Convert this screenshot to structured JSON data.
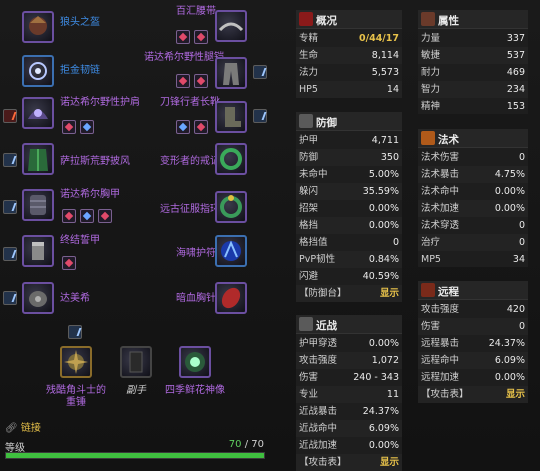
{
  "equipment": {
    "left": [
      {
        "name": "狼头之盔"
      },
      {
        "name": "拒金韧链"
      },
      {
        "name": "诺达希尔野性护肩"
      },
      {
        "name": "萨拉斯荒野披风"
      },
      {
        "name": "诺达希尔胸甲"
      },
      {
        "name": "终结誓甲"
      },
      {
        "name": "达美希"
      }
    ],
    "right": [
      {
        "name": "百汇腰带"
      },
      {
        "name": "诺达希尔野性腿铠"
      },
      {
        "name": "刀锋行者长靴"
      },
      {
        "name": "变形者的戒记"
      },
      {
        "name": "远古征服指环"
      },
      {
        "name": "海啸护符"
      },
      {
        "name": "暗血胸针"
      }
    ],
    "weapons": [
      {
        "name": "残酷角斗士的\n重锤"
      },
      {
        "name": "副手"
      },
      {
        "name": "四季鲜花神像"
      }
    ]
  },
  "link": {
    "label": "链接"
  },
  "level": {
    "label": "等级",
    "current": "70",
    "sep": "/",
    "max": "70",
    "progress": 1.0
  },
  "panels": {
    "overview": {
      "title": "概况",
      "rows": [
        {
          "k": "专精",
          "v": "0/44/17"
        },
        {
          "k": "生命",
          "v": "8,114"
        },
        {
          "k": "法力",
          "v": "5,573"
        },
        {
          "k": "HP5",
          "v": "14"
        }
      ]
    },
    "attributes": {
      "title": "属性",
      "rows": [
        {
          "k": "力量",
          "v": "337"
        },
        {
          "k": "敏捷",
          "v": "537"
        },
        {
          "k": "耐力",
          "v": "469"
        },
        {
          "k": "智力",
          "v": "234"
        },
        {
          "k": "精神",
          "v": "153"
        }
      ]
    },
    "defense": {
      "title": "防御",
      "rows": [
        {
          "k": "护甲",
          "v": "4,711"
        },
        {
          "k": "防御",
          "v": "350"
        },
        {
          "k": "未命中",
          "v": "5.00%"
        },
        {
          "k": "躲闪",
          "v": "35.59%"
        },
        {
          "k": "招架",
          "v": "0.00%"
        },
        {
          "k": "格挡",
          "v": "0.00%"
        },
        {
          "k": "格挡值",
          "v": "0"
        },
        {
          "k": "PvP韧性",
          "v": "0.84%"
        },
        {
          "k": "闪避",
          "v": "40.59%"
        },
        {
          "k": "【防御台】",
          "v": "显示"
        }
      ]
    },
    "spell": {
      "title": "法术",
      "rows": [
        {
          "k": "法术伤害",
          "v": "0"
        },
        {
          "k": "法术暴击",
          "v": "4.75%"
        },
        {
          "k": "法术命中",
          "v": "0.00%"
        },
        {
          "k": "法术加速",
          "v": "0.00%"
        },
        {
          "k": "法术穿透",
          "v": "0"
        },
        {
          "k": "治疗",
          "v": "0"
        },
        {
          "k": "MP5",
          "v": "34"
        }
      ]
    },
    "melee": {
      "title": "近战",
      "rows": [
        {
          "k": "护甲穿透",
          "v": "0.00%"
        },
        {
          "k": "攻击强度",
          "v": "1,072"
        },
        {
          "k": "伤害",
          "v": "240 - 343"
        },
        {
          "k": "专业",
          "v": "11"
        },
        {
          "k": "近战暴击",
          "v": "24.37%"
        },
        {
          "k": "近战命中",
          "v": "6.09%"
        },
        {
          "k": "近战加速",
          "v": "0.00%"
        },
        {
          "k": "【攻击表】",
          "v": "显示"
        }
      ]
    },
    "ranged": {
      "title": "远程",
      "rows": [
        {
          "k": "攻击强度",
          "v": "420"
        },
        {
          "k": "伤害",
          "v": "0"
        },
        {
          "k": "远程暴击",
          "v": "24.37%"
        },
        {
          "k": "远程命中",
          "v": "6.09%"
        },
        {
          "k": "远程加速",
          "v": "0.00%"
        },
        {
          "k": "【攻击表】",
          "v": "显示"
        }
      ]
    }
  },
  "colors": {
    "epic": "#b06ae0",
    "rare": "#3f8ee8",
    "accent": "#e8c24a",
    "level_bar": "#3fbf3f"
  }
}
